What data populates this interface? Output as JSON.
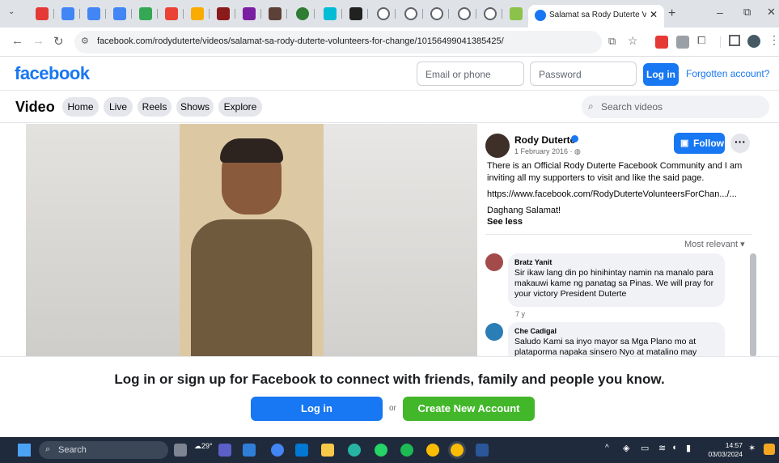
{
  "browser": {
    "tab_title": "Salamat sa Rody Duterte Volun",
    "url": "facebook.com/rodyduterte/videos/salamat-sa-rody-duterte-volunteers-for-change/10156499041385425/"
  },
  "fb_header": {
    "logo": "facebook",
    "email_placeholder": "Email or phone",
    "password_placeholder": "Password",
    "login": "Log in",
    "forgot": "Forgotten account?"
  },
  "video_nav": {
    "title": "Video",
    "tabs": [
      "Home",
      "Live",
      "Reels",
      "Shows",
      "Explore"
    ],
    "search_placeholder": "Search videos"
  },
  "post": {
    "author": "Rody Duterte",
    "date": "1 February 2016 · ",
    "follow": "Follow",
    "body": "There is an Official Rody Duterte Facebook Community and I am inviting all my supporters to visit and like the said page.",
    "link": "https://www.facebook.com/RodyDuterteVolunteersForChan.../...",
    "thanks": "Daghang Salamat!",
    "see_less": "See less",
    "sort": "Most relevant"
  },
  "comments": [
    {
      "name": "Bratz Yanit",
      "text": "Sir ikaw lang din po hinihintay namin na manalo para makauwi kame ng panatag sa Pinas. We will pray for your victory President Duterte",
      "age": "7 y"
    },
    {
      "name": "Che Cadigal",
      "text": "Saludo Kami sa inyo mayor sa Mga Plano mo at plataporma napaka sinsero Nyo at matalino may",
      "age": ""
    }
  ],
  "overlay": {
    "prompt": "Log in or sign up for Facebook to connect with friends, family and people you know.",
    "login": "Log in",
    "or": "or",
    "create": "Create New Account"
  },
  "taskbar": {
    "search": "Search",
    "weather": "29°",
    "time": "14:57",
    "date": "03/03/2024"
  },
  "colors": {
    "fb_blue": "#1877f2",
    "fb_green": "#42b72a"
  }
}
